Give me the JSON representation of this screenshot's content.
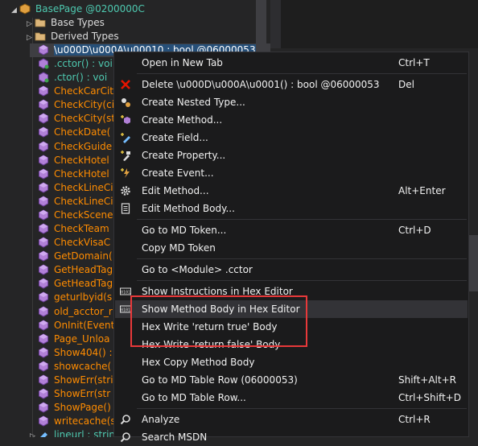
{
  "tree": {
    "root": {
      "label": "BasePage @0200000C",
      "icon": "class-icon"
    },
    "folders": [
      {
        "label": "Base Types",
        "icon": "folder-icon"
      },
      {
        "label": "Derived Types",
        "icon": "folder-icon"
      }
    ],
    "members": [
      {
        "label": "\\u000D\\u000A\\u00010 : bool @06000053",
        "kind": "grey",
        "icon": "method-icon",
        "selected": true
      },
      {
        "label": ".cctor() : voi",
        "kind": "ctor",
        "icon": "ctor-icon"
      },
      {
        "label": ".ctor() : voi",
        "kind": "ctor",
        "icon": "ctor-icon"
      },
      {
        "label": "CheckCarCit",
        "kind": "method",
        "icon": "method-icon"
      },
      {
        "label": "CheckCity(ci",
        "kind": "method",
        "icon": "method-icon"
      },
      {
        "label": "CheckCity(st",
        "kind": "method",
        "icon": "method-icon"
      },
      {
        "label": "CheckDate(",
        "kind": "method",
        "icon": "method-icon"
      },
      {
        "label": "CheckGuide",
        "kind": "method",
        "icon": "method-icon"
      },
      {
        "label": "CheckHotel",
        "kind": "method",
        "icon": "method-icon"
      },
      {
        "label": "CheckHotel",
        "kind": "method",
        "icon": "method-icon"
      },
      {
        "label": "CheckLineCi",
        "kind": "method",
        "icon": "method-icon"
      },
      {
        "label": "CheckLineCi",
        "kind": "method",
        "icon": "method-icon"
      },
      {
        "label": "CheckScene",
        "kind": "method",
        "icon": "method-icon"
      },
      {
        "label": "CheckTeam",
        "kind": "method",
        "icon": "method-icon"
      },
      {
        "label": "CheckVisaC",
        "kind": "method",
        "icon": "method-icon"
      },
      {
        "label": "GetDomain(",
        "kind": "method",
        "icon": "method-icon"
      },
      {
        "label": "GetHeadTag",
        "kind": "method",
        "icon": "method-icon"
      },
      {
        "label": "GetHeadTag",
        "kind": "method",
        "icon": "method-icon"
      },
      {
        "label": "geturlbyid(s",
        "kind": "method",
        "icon": "method-icon"
      },
      {
        "label": "old_acctor_r",
        "kind": "method",
        "icon": "method-icon"
      },
      {
        "label": "OnInit(Event",
        "kind": "method",
        "icon": "method-icon"
      },
      {
        "label": "Page_Unloa",
        "kind": "method",
        "icon": "method-icon"
      },
      {
        "label": "Show404() :",
        "kind": "method",
        "icon": "method-icon"
      },
      {
        "label": "showcache(",
        "kind": "method",
        "icon": "method-icon"
      },
      {
        "label": "ShowErr(stri",
        "kind": "method",
        "icon": "method-icon"
      },
      {
        "label": "ShowErr(str",
        "kind": "method",
        "icon": "method-icon"
      },
      {
        "label": "ShowPage()",
        "kind": "method",
        "icon": "method-icon"
      },
      {
        "label": "writecache(s",
        "kind": "method",
        "icon": "method-icon"
      },
      {
        "label": "lineurl : strin",
        "kind": "field",
        "icon": "field-icon"
      }
    ]
  },
  "menu": {
    "items": [
      {
        "label": "Open in New Tab",
        "shortcut": "Ctrl+T",
        "icon": ""
      },
      {
        "sep": true
      },
      {
        "label": "Delete \\u000D\\u000A\\u0001() : bool @06000053",
        "shortcut": "Del",
        "icon": "delete-icon"
      },
      {
        "label": "Create Nested Type...",
        "shortcut": "",
        "icon": "nested-type-icon"
      },
      {
        "label": "Create Method...",
        "shortcut": "",
        "icon": "create-method-icon"
      },
      {
        "label": "Create Field...",
        "shortcut": "",
        "icon": "create-field-icon"
      },
      {
        "label": "Create Property...",
        "shortcut": "",
        "icon": "create-property-icon"
      },
      {
        "label": "Create Event...",
        "shortcut": "",
        "icon": "create-event-icon"
      },
      {
        "label": "Edit Method...",
        "shortcut": "Alt+Enter",
        "icon": "gear-icon"
      },
      {
        "label": "Edit Method Body...",
        "shortcut": "",
        "icon": "document-icon"
      },
      {
        "sep": true
      },
      {
        "label": "Go to MD Token...",
        "shortcut": "Ctrl+D",
        "icon": ""
      },
      {
        "label": "Copy MD Token",
        "shortcut": "",
        "icon": ""
      },
      {
        "sep": true
      },
      {
        "label": "Go to <Module> .cctor",
        "shortcut": "",
        "icon": ""
      },
      {
        "sep": true
      },
      {
        "label": "Show Instructions in Hex Editor",
        "shortcut": "",
        "icon": "hex-editor-icon"
      },
      {
        "label": "Show Method Body in Hex Editor",
        "shortcut": "",
        "icon": "hex-editor-icon",
        "hover": true
      },
      {
        "label": "Hex Write 'return true' Body",
        "shortcut": "",
        "icon": ""
      },
      {
        "label": "Hex Write 'return false' Body",
        "shortcut": "",
        "icon": ""
      },
      {
        "label": "Hex Copy Method Body",
        "shortcut": "",
        "icon": ""
      },
      {
        "label": "Go to MD Table Row (06000053)",
        "shortcut": "Shift+Alt+R",
        "icon": ""
      },
      {
        "label": "Go to MD Table Row...",
        "shortcut": "Ctrl+Shift+D",
        "icon": ""
      },
      {
        "sep": true
      },
      {
        "label": "Analyze",
        "shortcut": "Ctrl+R",
        "icon": "search-icon"
      },
      {
        "label": "Search MSDN",
        "shortcut": "",
        "icon": "search-icon"
      }
    ]
  },
  "colors": {
    "method": "#ff8c00",
    "ctor": "#4ec9b0",
    "highlight_box": "#e8393a",
    "menu_bg": "#1b1b1c",
    "menu_hover": "#333337",
    "selection": "#264f78"
  }
}
